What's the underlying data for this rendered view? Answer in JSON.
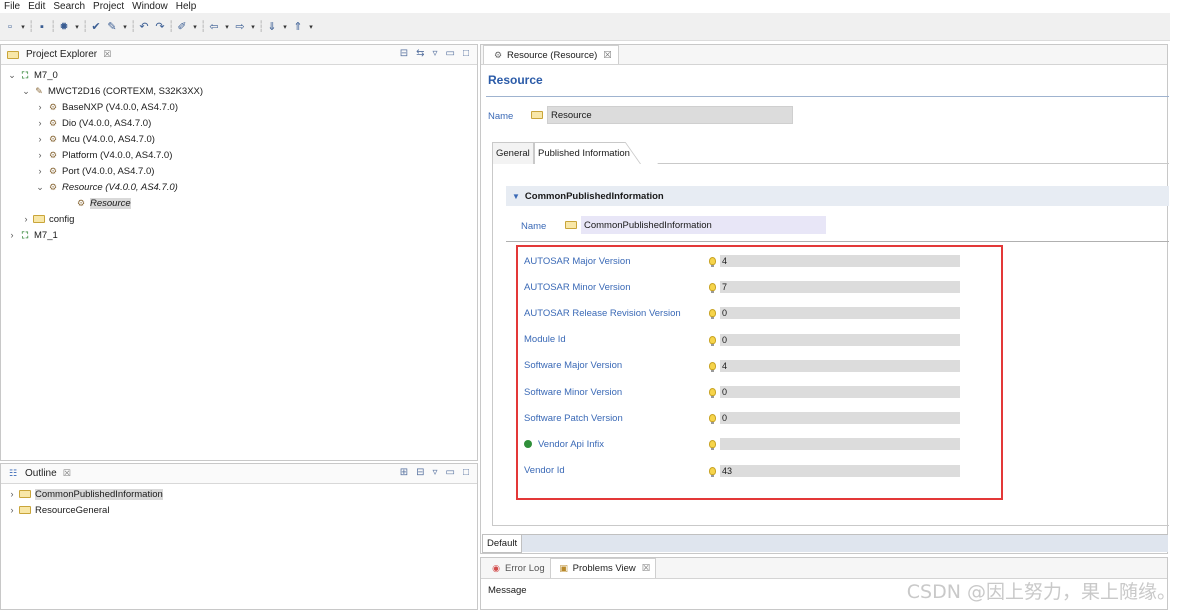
{
  "menu": [
    "File",
    "Edit",
    "Search",
    "Project",
    "Window",
    "Help"
  ],
  "project_explorer": {
    "title": "Project Explorer",
    "close_glyph": "☒",
    "tree": [
      {
        "label": "M7_0",
        "level": 0,
        "twist": "v",
        "icon": "project-icon"
      },
      {
        "label": "MWCT2D16 (CORTEXM, S32K3XX)",
        "level": 1,
        "twist": "v",
        "icon": "chip-icon"
      },
      {
        "label": "BaseNXP (V4.0.0, AS4.7.0)",
        "level": 2,
        "twist": ">",
        "icon": "module-icon"
      },
      {
        "label": "Dio (V4.0.0, AS4.7.0)",
        "level": 2,
        "twist": ">",
        "icon": "module-icon"
      },
      {
        "label": "Mcu (V4.0.0, AS4.7.0)",
        "level": 2,
        "twist": ">",
        "icon": "module-icon"
      },
      {
        "label": "Platform (V4.0.0, AS4.7.0)",
        "level": 2,
        "twist": ">",
        "icon": "module-icon"
      },
      {
        "label": "Port (V4.0.0, AS4.7.0)",
        "level": 2,
        "twist": ">",
        "icon": "module-icon"
      },
      {
        "label": "Resource (V4.0.0, AS4.7.0)",
        "level": 2,
        "twist": "v",
        "icon": "module-icon",
        "italic": true
      },
      {
        "label": "Resource",
        "level": 3,
        "twist": "",
        "icon": "config-icon",
        "italic": true,
        "selected": true
      },
      {
        "label": "config",
        "level": 1,
        "twist": ">",
        "icon": "folder-icon"
      },
      {
        "label": "M7_1",
        "level": 0,
        "twist": ">",
        "icon": "project-icon"
      }
    ]
  },
  "outline": {
    "title": "Outline",
    "close_glyph": "☒",
    "items": [
      {
        "label": "CommonPublishedInformation",
        "selected": true
      },
      {
        "label": "ResourceGeneral",
        "selected": false
      }
    ]
  },
  "editor": {
    "tab_label": "Resource (Resource)",
    "tab_close": "☒",
    "title": "Resource",
    "name_label": "Name",
    "name_value": "Resource",
    "tabs": [
      "General",
      "Published Information"
    ],
    "section_title": "CommonPublishedInformation",
    "section_name_label": "Name",
    "section_name_value": "CommonPublishedInformation",
    "params": [
      {
        "label": "AUTOSAR Major Version",
        "value": "4"
      },
      {
        "label": "AUTOSAR Minor Version",
        "value": "7"
      },
      {
        "label": "AUTOSAR Release Revision Version",
        "value": "0"
      },
      {
        "label": "Module Id",
        "value": "0"
      },
      {
        "label": "Software Major Version",
        "value": "4"
      },
      {
        "label": "Software Minor Version",
        "value": "0"
      },
      {
        "label": "Software Patch Version",
        "value": "0"
      },
      {
        "label": "Vendor Api Infix",
        "value": ""
      },
      {
        "label": "Vendor Id",
        "value": "43"
      }
    ],
    "bottom_tab": "Default"
  },
  "bottom_views": {
    "tabs": [
      "Error Log",
      "Problems View"
    ],
    "close_glyph": "☒",
    "column": "Message"
  },
  "watermark": "CSDN @因上努力，果上随缘。",
  "colors": {
    "highlight": "#e33838",
    "link": "#3a69b6"
  }
}
